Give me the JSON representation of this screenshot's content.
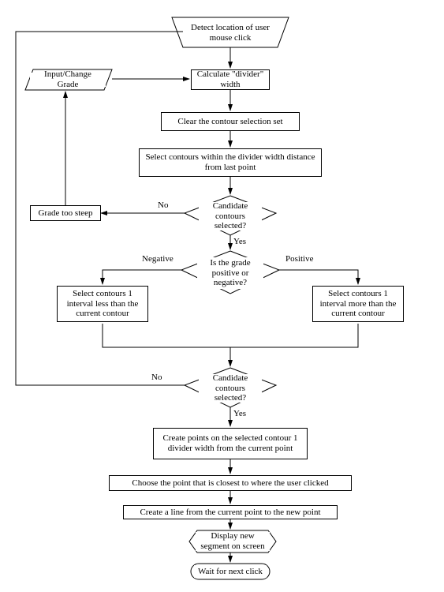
{
  "nodes": {
    "detect": "Detect location of user mouse click",
    "inputGrade": "Input/Change Grade",
    "calcDivider": "Calculate \"divider\" width",
    "clearSel": "Clear the contour selection set",
    "selectWithin": "Select contours within the divider width distance from last point",
    "decision1": "Candidate contours selected?",
    "gradeSign": "Is the grade positive or negative?",
    "gradeSteep": "Grade too steep",
    "selLess": "Select contours 1 interval less than the current contour",
    "selMore": "Select contours 1 interval more than the current contour",
    "decision2": "Candidate contours selected?",
    "createPts": "Create points on the selected contour 1 divider width from the current point",
    "choosePt": "Choose the point that is closest to where the user clicked",
    "createLine": "Create a line from the current point to the new point",
    "display": "Display new segment on screen",
    "wait": "Wait for next click"
  },
  "labels": {
    "no1": "No",
    "yes1": "Yes",
    "neg": "Negative",
    "pos": "Positive",
    "no2": "No",
    "yes2": "Yes"
  }
}
